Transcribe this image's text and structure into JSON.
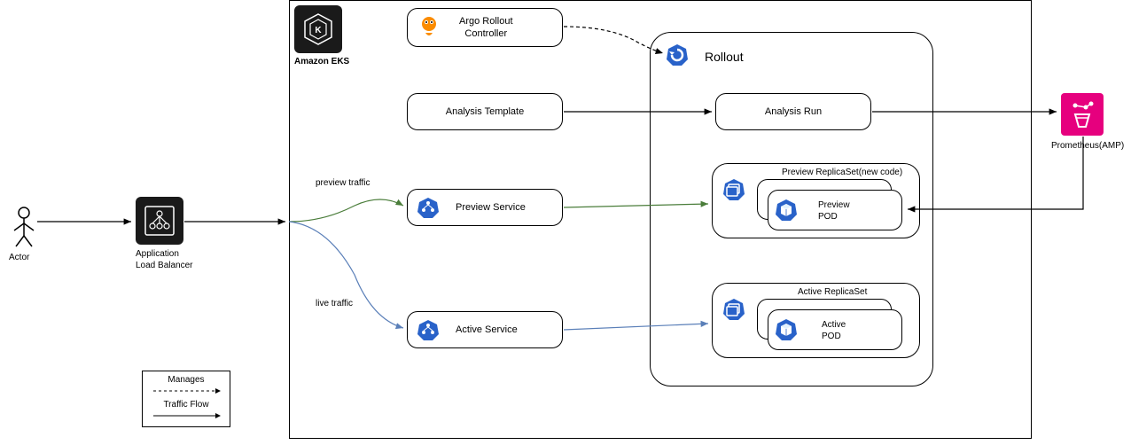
{
  "actor": {
    "label": "Actor"
  },
  "alb": {
    "title": "Application",
    "subtitle": "Load Balancer"
  },
  "eks": {
    "label": "Amazon EKS"
  },
  "argo": {
    "title": "Argo Rollout",
    "subtitle": "Controller"
  },
  "analysis_template": {
    "label": "Analysis Template"
  },
  "traffic": {
    "preview": "preview traffic",
    "live": "live traffic"
  },
  "preview_service": {
    "label": "Preview Service"
  },
  "active_service": {
    "label": "Active Service"
  },
  "rollout": {
    "label": "Rollout"
  },
  "analysis_run": {
    "label": "Analysis Run"
  },
  "preview_rs": {
    "title": "Preview ReplicaSet(new code)",
    "pod": "Preview POD"
  },
  "active_rs": {
    "title": "Active ReplicaSet",
    "pod": "Active POD"
  },
  "prometheus": {
    "label": "Prometheus(AMP)"
  },
  "legend": {
    "manages": "Manages",
    "traffic": "Traffic Flow"
  }
}
